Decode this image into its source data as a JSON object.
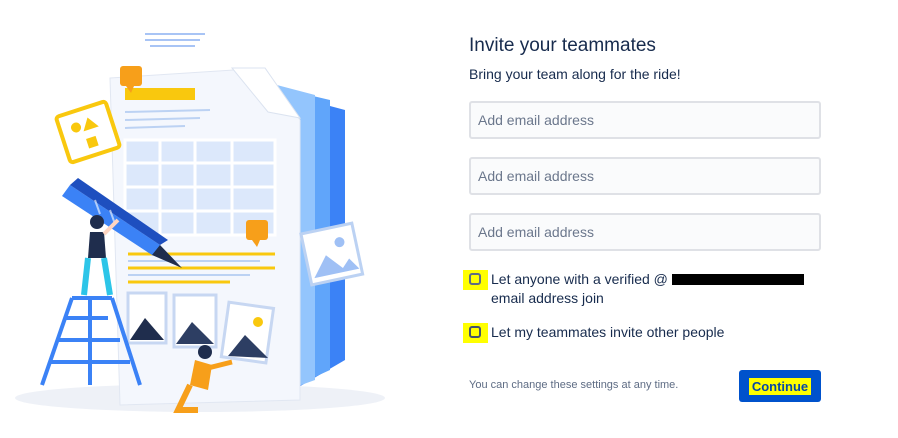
{
  "invite": {
    "title": "Invite your teammates",
    "subtitle": "Bring your team along for the ride!",
    "email_placeholders": [
      "Add email address",
      "Add email address",
      "Add email address"
    ],
    "options": [
      {
        "label_line1": "Let anyone with a verified @",
        "label_line2": "email address join"
      },
      {
        "label": "Let my teammates invite other people"
      }
    ],
    "hint": "You can change these settings at any time.",
    "continue_label": "Continue"
  },
  "colors": {
    "primary": "#0052cc",
    "highlight": "#ffff00",
    "text": "#172b4d",
    "input_border": "#dfe1e6"
  },
  "icons": [
    "document-illustration",
    "pencil-illustration",
    "ladder-illustration",
    "photo-frame-icon",
    "comment-icon"
  ]
}
